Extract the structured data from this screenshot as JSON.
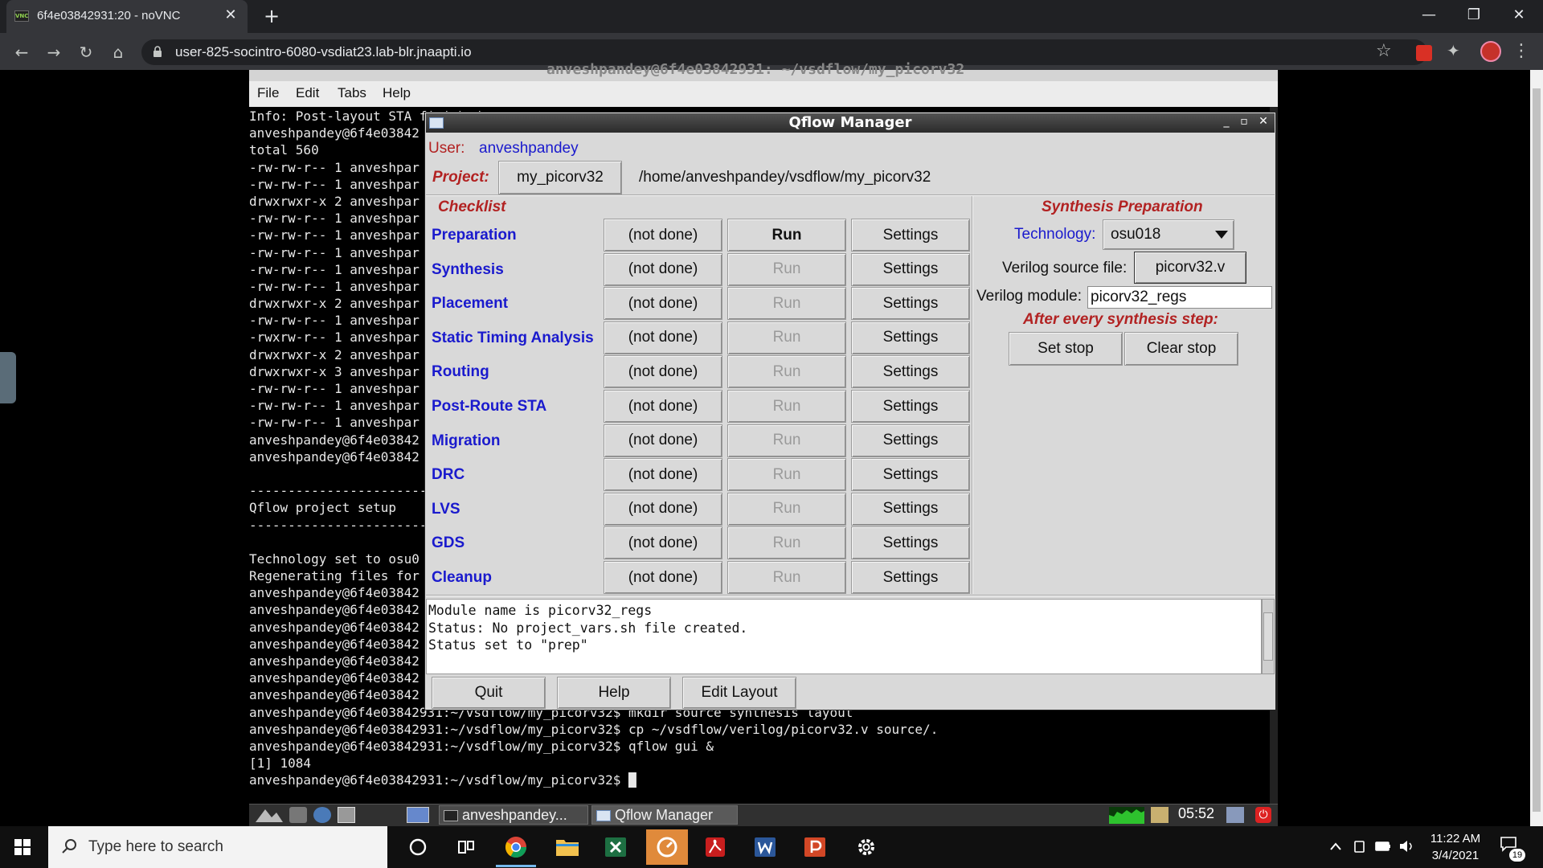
{
  "browser": {
    "tab_title": "6f4e03842931:20 - noVNC",
    "favicon_text": "VNC",
    "tab_close": "✕",
    "new_tab": "+",
    "url": "user-825-socintro-6080-vsdiat23.lab-blr.jnaapti.io",
    "window_controls": [
      "—",
      "❐",
      "✕"
    ]
  },
  "terminal": {
    "title": "anveshpandey@6f4e03842931: ~/vsdflow/my_picorv32",
    "menu": [
      "File",
      "Edit",
      "Tabs",
      "Help"
    ],
    "lines": [
      "Info: Post-layout STA finished",
      "anveshpandey@6f4e03842",
      "total 560",
      "-rw-rw-r-- 1 anveshpar",
      "-rw-rw-r-- 1 anveshpar",
      "drwxrwxr-x 2 anveshpar",
      "-rw-rw-r-- 1 anveshpar",
      "-rw-rw-r-- 1 anveshpar",
      "-rw-rw-r-- 1 anveshpar",
      "-rw-rw-r-- 1 anveshpar",
      "-rw-rw-r-- 1 anveshpar",
      "drwxrwxr-x 2 anveshpar",
      "-rw-rw-r-- 1 anveshpar",
      "-rwxrw-r-- 1 anveshpar",
      "drwxrwxr-x 2 anveshpar",
      "drwxrwxr-x 3 anveshpar",
      "-rw-rw-r-- 1 anveshpar",
      "-rw-rw-r-- 1 anveshpar",
      "-rw-rw-r-- 1 anveshpar",
      "anveshpandey@6f4e03842",
      "anveshpandey@6f4e03842",
      "",
      "-----------------------",
      "Qflow project setup",
      "-----------------------",
      "",
      "Technology set to osu0",
      "Regenerating files for",
      "anveshpandey@6f4e03842",
      "anveshpandey@6f4e03842",
      "anveshpandey@6f4e03842",
      "anveshpandey@6f4e03842",
      "anveshpandey@6f4e03842",
      "anveshpandey@6f4e03842",
      "anveshpandey@6f4e03842",
      "anveshpandey@6f4e03842931:~/vsdflow/my_picorv32$ mkdir source synthesis layout",
      "anveshpandey@6f4e03842931:~/vsdflow/my_picorv32$ cp ~/vsdflow/verilog/picorv32.v source/.",
      "anveshpandey@6f4e03842931:~/vsdflow/my_picorv32$ qflow gui &",
      "[1] 1084",
      "anveshpandey@6f4e03842931:~/vsdflow/my_picorv32$ █"
    ]
  },
  "lxpanel": {
    "tasks": [
      "anveshpandey...",
      "Qflow Manager"
    ],
    "clock": "05:52"
  },
  "qflow": {
    "title": "Qflow Manager",
    "user_label": "User:",
    "user_value": "anveshpandey",
    "project_label": "Project:",
    "project_button": "my_picorv32",
    "project_path": "/home/anveshpandey/vsdflow/my_picorv32",
    "checklist_label": "Checklist",
    "steps": [
      {
        "name": "Preparation",
        "status": "(not done)",
        "run": "Run",
        "settings": "Settings"
      },
      {
        "name": "Synthesis",
        "status": "(not done)",
        "run": "Run",
        "settings": "Settings"
      },
      {
        "name": "Placement",
        "status": "(not done)",
        "run": "Run",
        "settings": "Settings"
      },
      {
        "name": "Static Timing Analysis",
        "status": "(not done)",
        "run": "Run",
        "settings": "Settings"
      },
      {
        "name": "Routing",
        "status": "(not done)",
        "run": "Run",
        "settings": "Settings"
      },
      {
        "name": "Post-Route STA",
        "status": "(not done)",
        "run": "Run",
        "settings": "Settings"
      },
      {
        "name": "Migration",
        "status": "(not done)",
        "run": "Run",
        "settings": "Settings"
      },
      {
        "name": "DRC",
        "status": "(not done)",
        "run": "Run",
        "settings": "Settings"
      },
      {
        "name": "LVS",
        "status": "(not done)",
        "run": "Run",
        "settings": "Settings"
      },
      {
        "name": "GDS",
        "status": "(not done)",
        "run": "Run",
        "settings": "Settings"
      },
      {
        "name": "Cleanup",
        "status": "(not done)",
        "run": "Run",
        "settings": "Settings"
      }
    ],
    "synth_prep_title": "Synthesis Preparation",
    "technology_label": "Technology:",
    "technology_value": "osu018",
    "verilog_source_label": "Verilog source file:",
    "verilog_source_value": "picorv32.v",
    "verilog_module_label": "Verilog module:",
    "verilog_module_value": "picorv32_regs",
    "after_step_label": "After every synthesis step:",
    "set_stop": "Set stop",
    "clear_stop": "Clear stop",
    "log": [
      "Module name is picorv32_regs",
      "Status: No project_vars.sh file created.",
      "Status set to \"prep\""
    ],
    "quit": "Quit",
    "help": "Help",
    "edit_layout": "Edit Layout"
  },
  "windows": {
    "search_placeholder": "Type here to search",
    "time": "11:22 AM",
    "date": "3/4/2021",
    "notifications": "19"
  }
}
